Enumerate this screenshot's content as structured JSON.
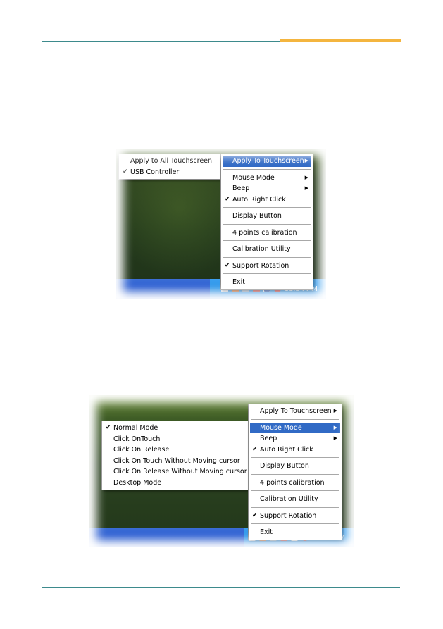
{
  "screenshot1": {
    "submenu": [
      {
        "label": "Apply to All Touchscreen",
        "checked": false
      },
      {
        "label": "USB Controller",
        "checked": true
      }
    ],
    "menu": [
      {
        "label": "Apply To Touchscreen",
        "submenu": true,
        "highlighted": true
      },
      {
        "separator": true
      },
      {
        "label": "Mouse Mode",
        "submenu": true
      },
      {
        "label": "Beep",
        "submenu": true
      },
      {
        "label": "Auto Right Click",
        "checked": true
      },
      {
        "separator": true
      },
      {
        "label": "Display Button"
      },
      {
        "separator": true
      },
      {
        "label": "4 points calibration"
      },
      {
        "separator": true
      },
      {
        "label": "Calibration Utility"
      },
      {
        "separator": true
      },
      {
        "label": "Support Rotation",
        "checked": true
      },
      {
        "separator": true
      },
      {
        "label": "Exit"
      }
    ],
    "clock": "11:24 AM"
  },
  "screenshot2": {
    "submenu": [
      {
        "label": "Normal Mode",
        "checked": true
      },
      {
        "label": "Click OnTouch",
        "checked": false
      },
      {
        "label": "Click On Release",
        "checked": false
      },
      {
        "label": "Click On Touch Without Moving cursor",
        "checked": false
      },
      {
        "label": "Click On Release Without Moving cursor",
        "checked": false
      },
      {
        "label": "Desktop Mode",
        "checked": false
      }
    ],
    "menu": [
      {
        "label": "Apply To Touchscreen",
        "submenu": true
      },
      {
        "separator": true
      },
      {
        "label": "Mouse Mode",
        "submenu": true,
        "highlighted": true
      },
      {
        "label": "Beep",
        "submenu": true
      },
      {
        "label": "Auto Right Click",
        "checked": true
      },
      {
        "separator": true
      },
      {
        "label": "Display Button"
      },
      {
        "separator": true
      },
      {
        "label": "4 points calibration"
      },
      {
        "separator": true
      },
      {
        "label": "Calibration Utility"
      },
      {
        "separator": true
      },
      {
        "label": "Support Rotation",
        "checked": true
      },
      {
        "separator": true
      },
      {
        "label": "Exit"
      }
    ],
    "clock": "11:25 AM"
  },
  "icons": {
    "check": "✔",
    "arrow": "▶"
  },
  "colors": {
    "accent_teal": "#3d8a8c",
    "accent_orange": "#f4b53f",
    "menu_highlight": "#316ac5",
    "taskbar_blue": "#2458d0"
  }
}
